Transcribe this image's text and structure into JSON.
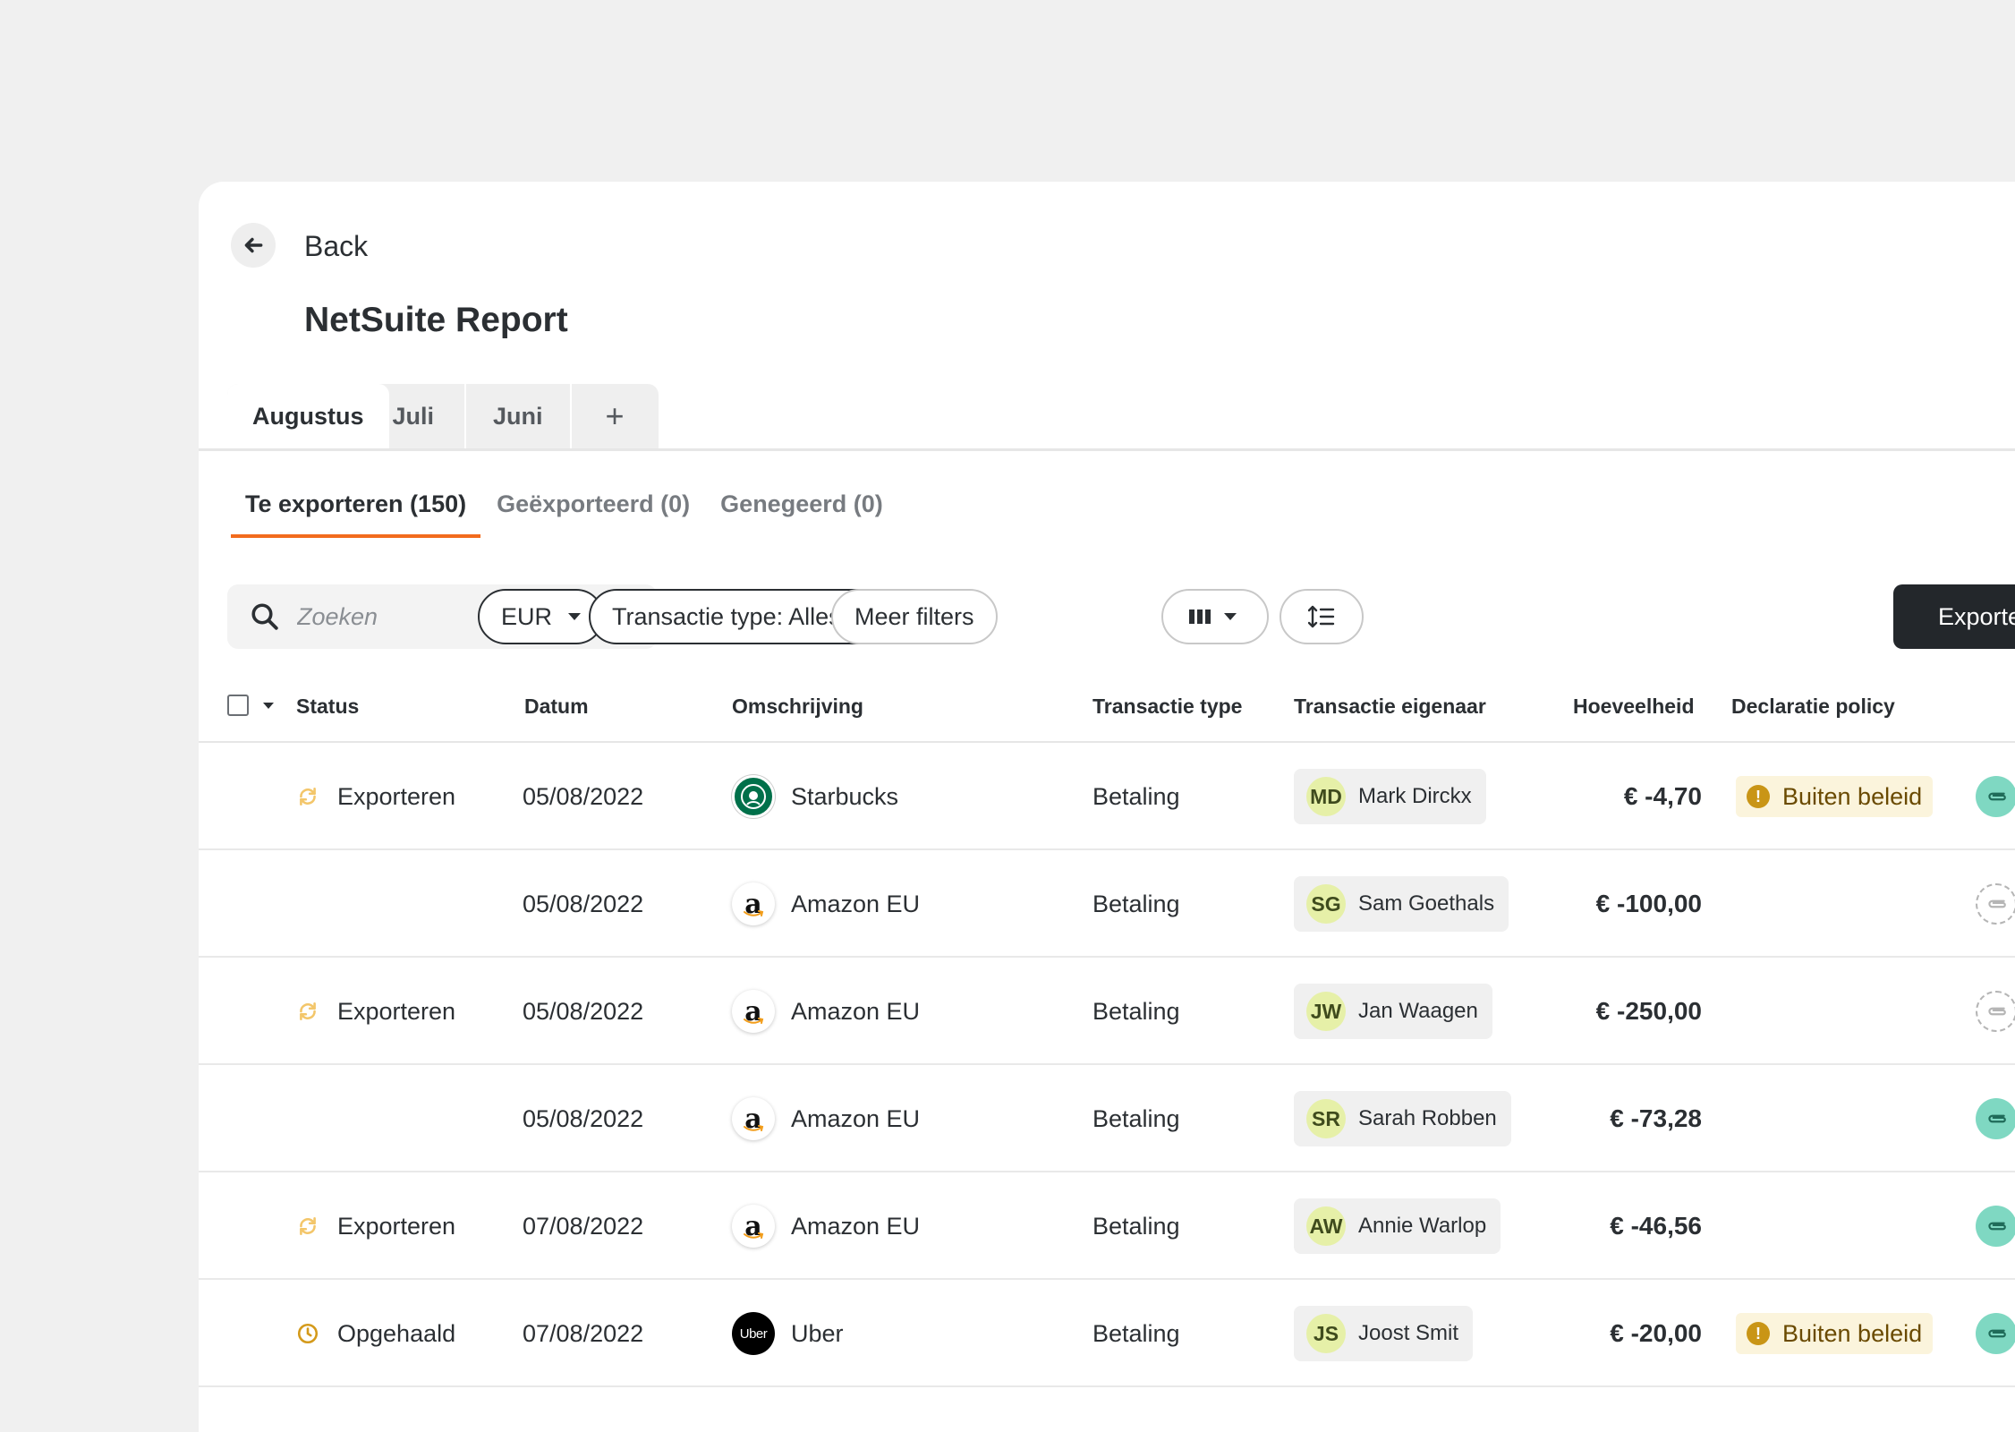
{
  "nav": {
    "back_label": "Back"
  },
  "page": {
    "title": "NetSuite Report"
  },
  "month_tabs": [
    "Augustus",
    "Juli",
    "Juni"
  ],
  "month_tab_add": "+",
  "sub_tabs": [
    "Te exporteren (150)",
    "Geëxporteerd (0)",
    "Genegeerd (0)"
  ],
  "search": {
    "placeholder": "Zoeken"
  },
  "filters": {
    "currency": "EUR",
    "transaction_type": "Transactie type: Alles",
    "more": "Meer filters"
  },
  "export_label": "Exporte",
  "columns": {
    "status": "Status",
    "date": "Datum",
    "description": "Omschrijving",
    "type": "Transactie type",
    "owner": "Transactie eigenaar",
    "amount": "Hoeveelheid",
    "policy": "Declaratie policy"
  },
  "rows": [
    {
      "status": "Exporteren",
      "status_icon": "sync-icon",
      "date": "05/08/2022",
      "merchant": "Starbucks",
      "logo": "starbucks",
      "type": "Betaling",
      "initials": "MD",
      "owner": "Mark Dirckx",
      "amount": "€ -4,70",
      "policy": "Buiten beleid",
      "receipt": true
    },
    {
      "status": "",
      "status_icon": "",
      "date": "05/08/2022",
      "merchant": "Amazon  EU",
      "logo": "amazon",
      "type": "Betaling",
      "initials": "SG",
      "owner": "Sam Goethals",
      "amount": "€ -100,00",
      "policy": "",
      "receipt": false
    },
    {
      "status": "Exporteren",
      "status_icon": "sync-icon",
      "date": "05/08/2022",
      "merchant": "Amazon EU",
      "logo": "amazon",
      "type": "Betaling",
      "initials": "JW",
      "owner": "Jan Waagen",
      "amount": "€ -250,00",
      "policy": "",
      "receipt": false
    },
    {
      "status": "",
      "status_icon": "",
      "date": "05/08/2022",
      "merchant": "Amazon EU",
      "logo": "amazon",
      "type": "Betaling",
      "initials": "SR",
      "owner": "Sarah Robben",
      "amount": "€ -73,28",
      "policy": "",
      "receipt": true
    },
    {
      "status": "Exporteren",
      "status_icon": "sync-icon",
      "date": "07/08/2022",
      "merchant": "Amazon EU",
      "logo": "amazon",
      "type": "Betaling",
      "initials": "AW",
      "owner": "Annie  Warlop",
      "amount": "€ -46,56",
      "policy": "",
      "receipt": true
    },
    {
      "status": "Opgehaald",
      "status_icon": "clock-icon",
      "date": "07/08/2022",
      "merchant": "Uber",
      "logo": "uber",
      "logo_text": "Uber",
      "type": "Betaling",
      "initials": "JS",
      "owner": "Joost Smit",
      "amount": "€ -20,00",
      "policy": "Buiten beleid",
      "receipt": true
    }
  ],
  "colors": {
    "accent": "#f26b1d",
    "primary_button": "#23272b",
    "receipt_attached": "#7fd8c2",
    "warning": "#c99516"
  }
}
